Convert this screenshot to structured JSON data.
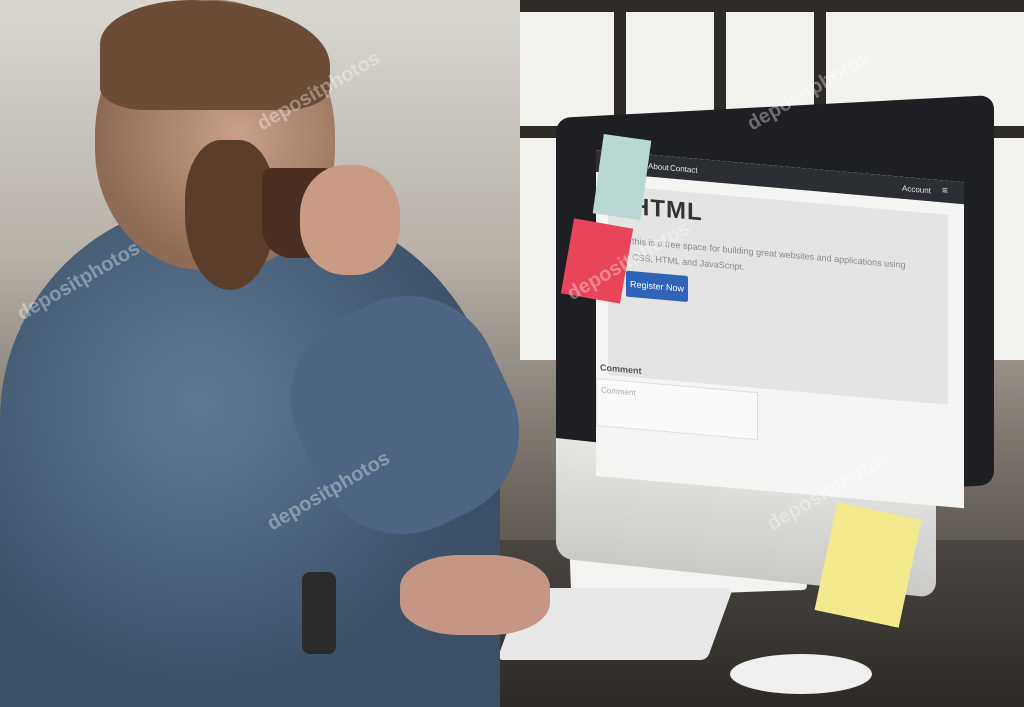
{
  "screen": {
    "nav": {
      "about": "About",
      "contact": "Contact",
      "account": "Account",
      "menu_icon": "≡"
    },
    "hero": {
      "title": "HTML",
      "text": "this is a free space for building great websites and applications using CSS, HTML and JavaScript.",
      "cta": "Register Now"
    },
    "comment": {
      "label": "Comment",
      "placeholder": "Comment"
    }
  },
  "watermarks": [
    "depositphotos",
    "depositphotos",
    "depositphotos",
    "depositphotos",
    "depositphotos",
    "depositphotos"
  ]
}
